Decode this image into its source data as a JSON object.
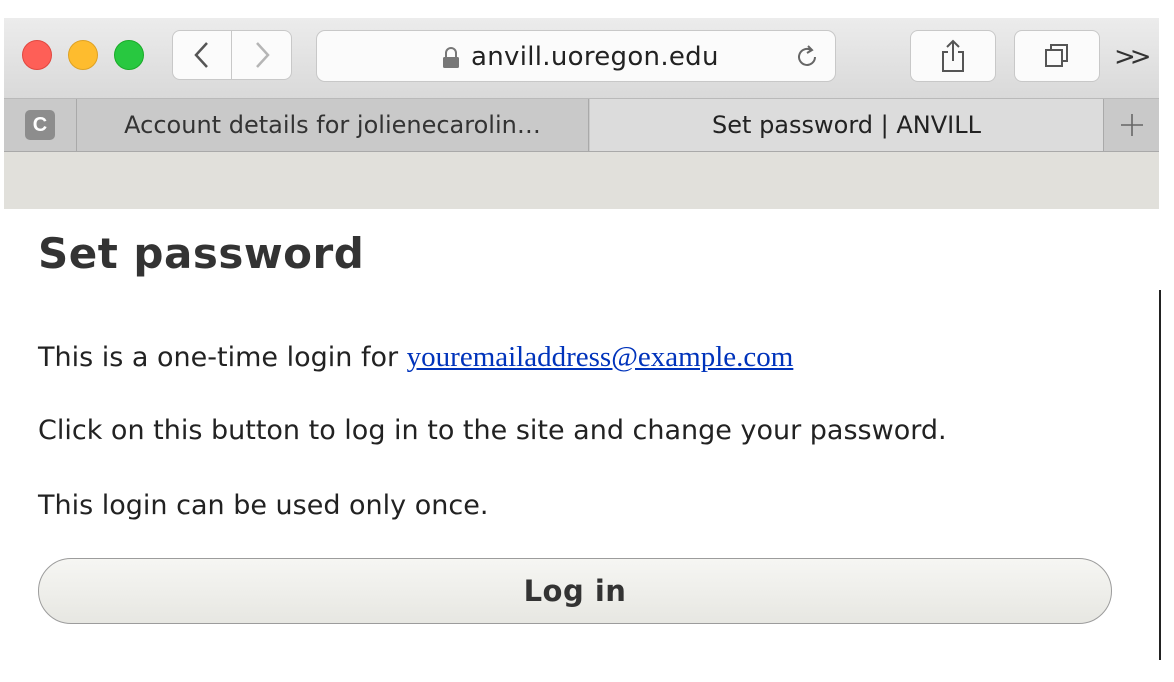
{
  "browser": {
    "address": {
      "url": "anvill.uoregon.edu"
    },
    "tabs": [
      {
        "label": "Account details for jolienecarolin…",
        "active": false
      },
      {
        "label": "Set password | ANVILL",
        "active": true
      }
    ],
    "pinned_tab": {
      "letter": "C"
    },
    "more_label": ">>"
  },
  "page": {
    "title": "Set password",
    "login_prefix": "This is a one-time login for ",
    "email_link": "youremailaddress@example.com",
    "instruction": "Click on this button to log in to the site and change your password.",
    "once_note": "This login can be used only once.",
    "login_button": "Log in"
  },
  "colors": {
    "close": "#fe5f57",
    "minimize": "#febc2e",
    "zoom": "#28c840",
    "link": "#0033bb",
    "header_strip": "#e1e0db"
  },
  "icons": [
    "close-icon",
    "minimize-icon",
    "zoom-icon",
    "chevron-left-icon",
    "chevron-right-icon",
    "lock-icon",
    "reload-icon",
    "share-icon",
    "tabs-overview-icon",
    "more-chevron-icon",
    "plus-icon"
  ]
}
